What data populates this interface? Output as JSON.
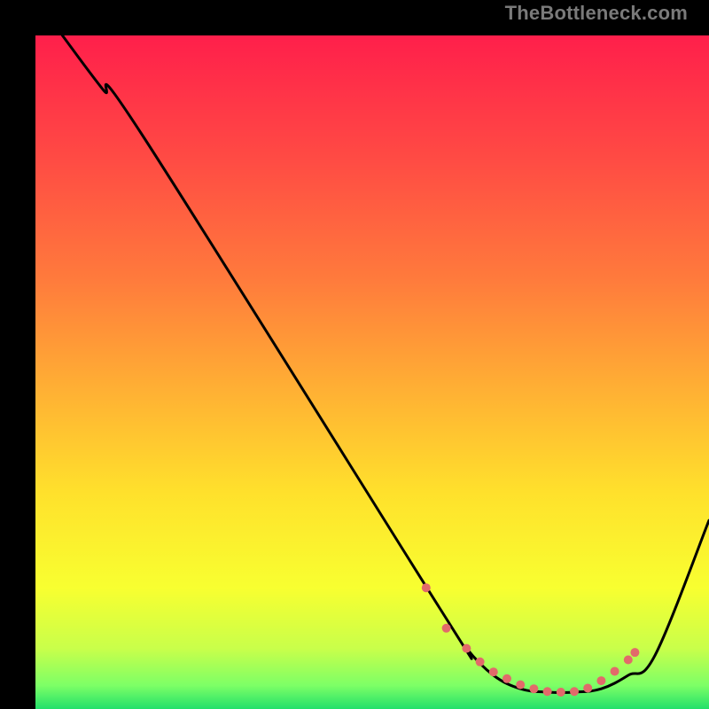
{
  "watermark": "TheBottleneck.com",
  "gradient": {
    "stops": [
      {
        "offset": 0.0,
        "color": "#ff1f4b"
      },
      {
        "offset": 0.18,
        "color": "#ff4a44"
      },
      {
        "offset": 0.36,
        "color": "#ff7a3c"
      },
      {
        "offset": 0.52,
        "color": "#ffae34"
      },
      {
        "offset": 0.68,
        "color": "#ffe12c"
      },
      {
        "offset": 0.82,
        "color": "#f8ff30"
      },
      {
        "offset": 0.91,
        "color": "#c9ff4a"
      },
      {
        "offset": 0.965,
        "color": "#7dff66"
      },
      {
        "offset": 1.0,
        "color": "#22e06a"
      }
    ]
  },
  "chart_data": {
    "type": "line",
    "title": "",
    "xlabel": "",
    "ylabel": "",
    "xlim": [
      0,
      100
    ],
    "ylim": [
      0,
      100
    ],
    "series": [
      {
        "name": "curve",
        "x": [
          4,
          10,
          16,
          60,
          64,
          68,
          72,
          76,
          80,
          84,
          88,
          92,
          100
        ],
        "y": [
          100,
          92,
          85,
          15,
          9,
          5,
          3,
          2.5,
          2.5,
          3,
          5,
          8,
          28
        ]
      }
    ],
    "markers": {
      "name": "highlight-points",
      "x": [
        58,
        61,
        64,
        66,
        68,
        70,
        72,
        74,
        76,
        78,
        80,
        82,
        84,
        86,
        88,
        89
      ],
      "y": [
        18,
        12,
        9,
        7,
        5.5,
        4.5,
        3.6,
        3.0,
        2.6,
        2.5,
        2.6,
        3.1,
        4.2,
        5.6,
        7.3,
        8.4
      ],
      "color": "#e26a6a",
      "radius": 5
    }
  }
}
